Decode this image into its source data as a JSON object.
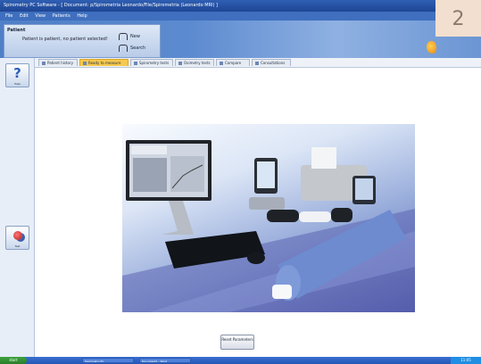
{
  "window": {
    "title": "Spirometry PC Software - [ Document: p/Spirometria Leonardo/File/Spirometria (Leonardo MRI) ]"
  },
  "menu": {
    "items": [
      "File",
      "Edit",
      "View",
      "Patients",
      "Help"
    ]
  },
  "patient": {
    "title": "Patient",
    "text": "Patient is patient, no patient selected!",
    "new_label": "New",
    "search_label": "Search"
  },
  "badge": {
    "number": "2"
  },
  "tabs": [
    {
      "label": "Patient history",
      "active": false
    },
    {
      "label": "Ready to measure",
      "active": true
    },
    {
      "label": "Spirometry tests",
      "active": false
    },
    {
      "label": "Oximetry tests",
      "active": false
    },
    {
      "label": "Compare",
      "active": false
    },
    {
      "label": "Consultations",
      "active": false
    }
  ],
  "sidebar": {
    "help_label": "Help",
    "measure_label": "Test"
  },
  "reset_button": {
    "label": "Reset Parameters"
  },
  "taskbar": {
    "start_label": "start",
    "tasks": [
      "Spirometry PC",
      "Document1 - Word"
    ],
    "clock": "11:05"
  },
  "colors": {
    "title_bar": "#1e4593",
    "header": "#5d8bd0",
    "active_tab": "#f7c94e",
    "badge_bg": "#f2dfcf",
    "taskbar": "#2356b5"
  },
  "icons": {
    "help": "help-icon",
    "measure": "measure-icon",
    "new": "new-patient-icon",
    "search": "search-patient-icon",
    "logo": "logo-icon"
  }
}
